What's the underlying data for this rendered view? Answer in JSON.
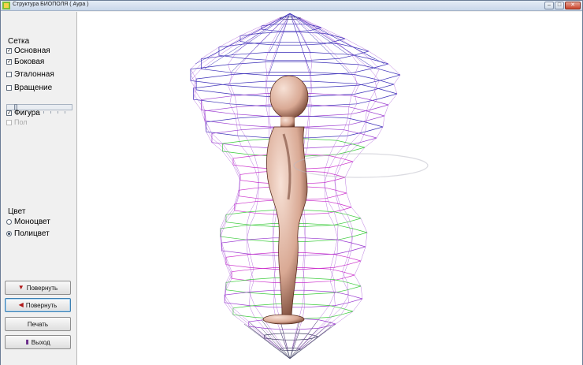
{
  "window": {
    "title": "Структура БИОПОЛЯ ( Аура )"
  },
  "sidebar": {
    "grid_group": "Сетка",
    "grid_options": [
      {
        "label": "Основная",
        "checked": true
      },
      {
        "label": "Боковая",
        "checked": true
      },
      {
        "label": "Эталонная",
        "checked": false
      }
    ],
    "rotation": {
      "label": "Вращение",
      "checked": false
    },
    "figure": {
      "label": "Фигура",
      "checked": true
    },
    "floor": {
      "label": "Пол",
      "checked": false,
      "disabled": true
    },
    "color_group": "Цвет",
    "color_options": [
      {
        "label": "Моноцвет",
        "selected": false
      },
      {
        "label": "Полицвет",
        "selected": true
      }
    ]
  },
  "buttons": {
    "rotate_down": "Повернуть",
    "rotate_left": "Повернуть",
    "print": "Печать",
    "exit": "Выход"
  },
  "icons": {
    "rotate_down": "arrow-down-icon",
    "rotate_left": "arrow-left-icon",
    "exit": "exit-door-icon"
  },
  "colors": {
    "mesh_blue": "#3b2fb8",
    "mesh_purple": "#9a3ad0",
    "mesh_magenta": "#cc33cc",
    "mesh_green": "#3dcc3d",
    "mesh_dark": "#444466",
    "figure_skin": "#d9a994"
  }
}
